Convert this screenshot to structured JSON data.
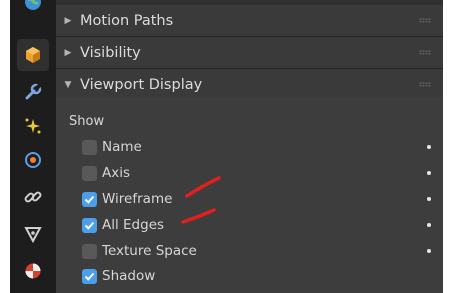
{
  "panels": {
    "motion_paths": "Motion Paths",
    "visibility": "Visibility",
    "viewport_display": "Viewport Display"
  },
  "viewport_display": {
    "show_label": "Show",
    "options": [
      {
        "label": "Name",
        "checked": false,
        "dot": true
      },
      {
        "label": "Axis",
        "checked": false,
        "dot": true
      },
      {
        "label": "Wireframe",
        "checked": true,
        "dot": true
      },
      {
        "label": "All Edges",
        "checked": true,
        "dot": true
      },
      {
        "label": "Texture Space",
        "checked": false,
        "dot": true
      },
      {
        "label": "Shadow",
        "checked": true,
        "dot": false
      }
    ]
  },
  "tabs": [
    "world-icon",
    "object-icon",
    "modifier-wrench-icon",
    "particles-icon",
    "physics-icon",
    "constraints-icon",
    "data-mesh-icon",
    "material-icon"
  ],
  "colors": {
    "accent_checkbox": "#4b9fea",
    "annotation_red": "#e0201e",
    "object_tab_orange": "#f0a030"
  }
}
